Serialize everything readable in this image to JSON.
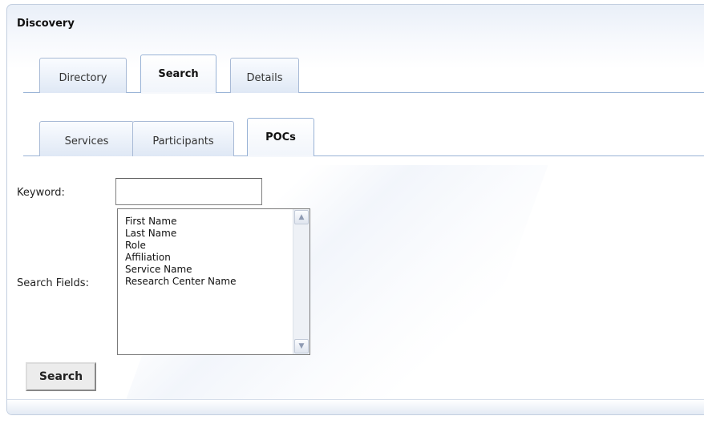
{
  "panel": {
    "title": "Discovery"
  },
  "main_tabs": [
    {
      "label": "Directory",
      "active": false
    },
    {
      "label": "Search",
      "active": true
    },
    {
      "label": "Details",
      "active": false
    }
  ],
  "sub_tabs": [
    {
      "label": "Services",
      "active": false
    },
    {
      "label": "Participants",
      "active": false
    },
    {
      "label": "POCs",
      "active": true
    }
  ],
  "form": {
    "keyword_label": "Keyword:",
    "keyword_value": "",
    "search_fields_label": "Search Fields:",
    "search_fields_options": [
      "First Name",
      "Last Name",
      "Role",
      "Affiliation",
      "Service Name",
      "Research Center Name"
    ],
    "submit_label": "Search"
  },
  "colors": {
    "tab_border": "#a8bad6",
    "tab_baseline": "#99b3d6",
    "panel_border": "#c3cfe0"
  }
}
